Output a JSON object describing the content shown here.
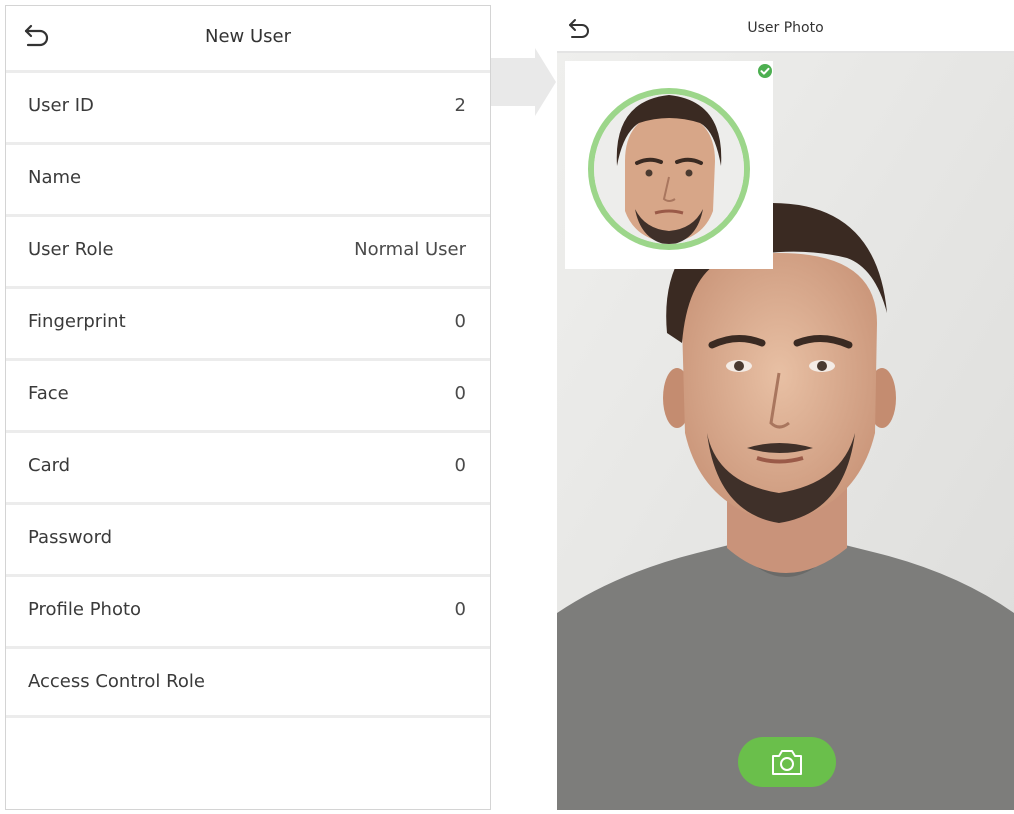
{
  "left_screen": {
    "title": "New User",
    "rows": [
      {
        "label": "User ID",
        "value": "2"
      },
      {
        "label": "Name",
        "value": ""
      },
      {
        "label": "User Role",
        "value": "Normal User"
      },
      {
        "label": "Fingerprint",
        "value": "0"
      },
      {
        "label": "Face",
        "value": "0"
      },
      {
        "label": "Card",
        "value": "0"
      },
      {
        "label": "Password",
        "value": ""
      },
      {
        "label": "Profile Photo",
        "value": "0"
      },
      {
        "label": "Access Control Role",
        "value": ""
      }
    ]
  },
  "right_screen": {
    "title": "User Photo",
    "icons": {
      "back": "back-arrow-icon",
      "capture": "camera-icon",
      "confirm": "check-icon"
    },
    "accent_color": "#6abf4b"
  }
}
